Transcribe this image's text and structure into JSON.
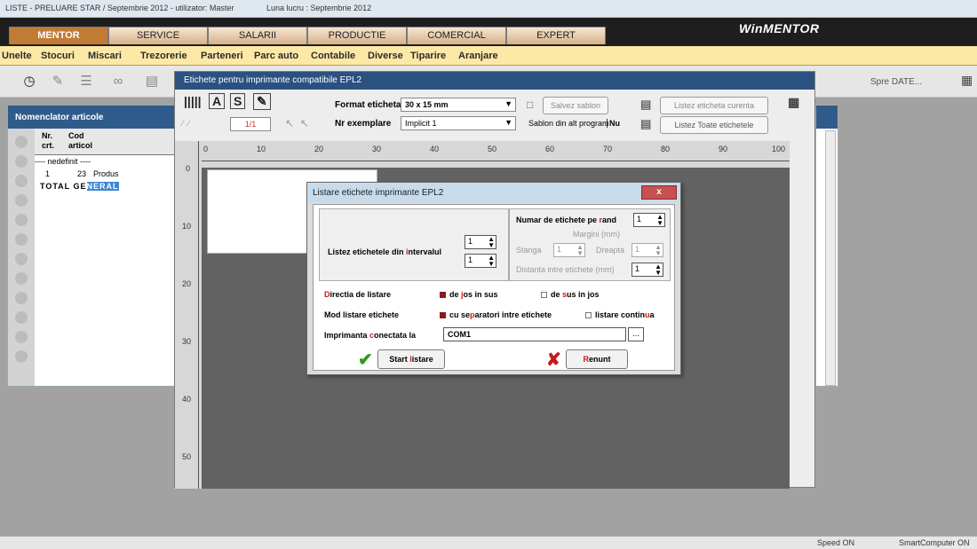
{
  "window": {
    "title": "LISTE - PRELUARE STAR / Septembrie 2012 - utilizator: Master",
    "luna": "Luna lucru : Septembrie 2012"
  },
  "topnav": {
    "tabs": [
      "MENTOR",
      "SERVICE",
      "SALARII",
      "PRODUCTIE",
      "COMERCIAL",
      "EXPERT"
    ],
    "brand": "WinMENTOR"
  },
  "menubar": {
    "items": [
      "Unelte",
      "Stocuri",
      "Miscari",
      "Trezorerie",
      "Parteneri",
      "Parc auto",
      "Contabile",
      "Diverse",
      "Tiparire",
      "Aranjare"
    ]
  },
  "toolbar": {
    "spre": "Spre DATE..."
  },
  "nomenclator": {
    "title": "Nomenclator articole",
    "col_nr": "Nr.\ncrt.",
    "col_cod": "Cod\narticol",
    "group_row": "---- nedefinit ----",
    "row": {
      "nr": "1",
      "cod": "23",
      "name": "Produs"
    },
    "total_a": "TOTAL GE",
    "total_b": "NERAL"
  },
  "etichete": {
    "title": "Etichete pentru imprimante compatibile EPL2",
    "format_label": "Format eticheta",
    "format_value": "30 x 15 mm",
    "nrex_label": "Nr exemplare",
    "nrex_value": "Implicit 1",
    "pager": "1/1",
    "salvez": "Salvez sablon",
    "sablon_alt": "Sablon din alt program",
    "sablon_value": "Nu",
    "listez_curenta": "Listez eticheta curenta",
    "listez_toate": "Listez Toate etichetele",
    "ruler_h": [
      "0",
      "10",
      "20",
      "30",
      "40",
      "50",
      "60",
      "70",
      "80",
      "90",
      "100"
    ],
    "ruler_v": [
      "0",
      "10",
      "20",
      "30",
      "40",
      "50"
    ]
  },
  "dialog": {
    "title": "Listare etichete imprimante EPL2",
    "close": "x",
    "interval_label": "Listez etichetele din intervalul",
    "interval_from": "1",
    "interval_to": "1",
    "per_rand_label": "Numar de etichete pe rand",
    "per_rand_value": "1",
    "margini": "Margini (mm)",
    "stanga": "Stanga",
    "stanga_val": "1",
    "dreapta": "Dreapta",
    "dreapta_val": "1",
    "distanta": "Distanta intre etichete (mm)",
    "distanta_val": "1",
    "directia_label": "Directia de listare",
    "dir_opt1": "de jos in sus",
    "dir_opt2": "de sus in jos",
    "mod_label": "Mod listare etichete",
    "mod_opt1": "cu separatori intre etichete",
    "mod_opt2": "listare continua",
    "imprimanta_label": "Imprimanta conectata la",
    "imprimanta_value": "COM1",
    "browse": "...",
    "start": "Start listare",
    "renunt": "Renunt"
  },
  "status": {
    "speed": "Speed ON",
    "smart": "SmartComputer ON"
  }
}
